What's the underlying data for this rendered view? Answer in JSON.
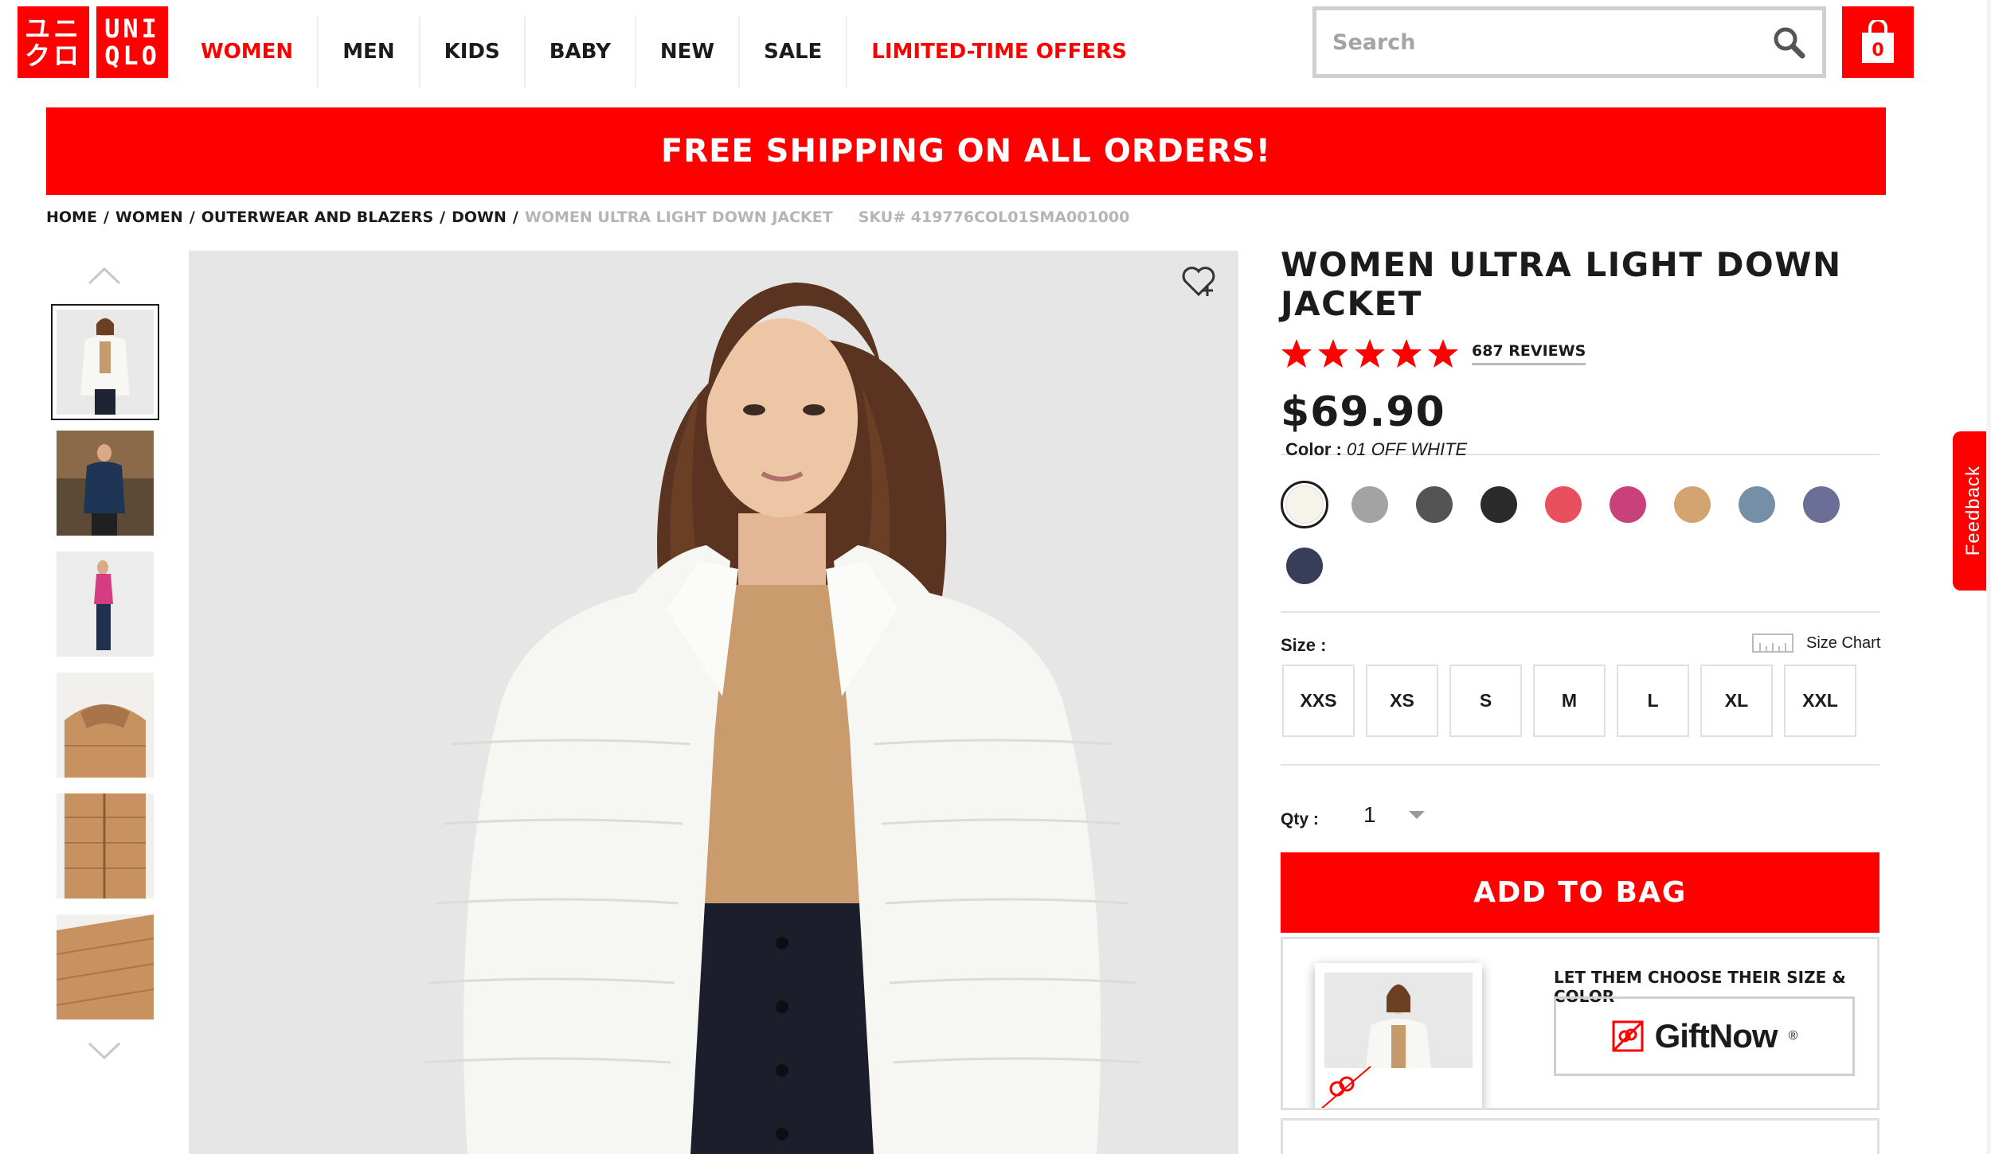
{
  "header": {
    "logo": {
      "top_left": "ユニ",
      "bottom_left": "クロ",
      "top_right": "UNI",
      "bottom_right": "QLO"
    },
    "nav": [
      {
        "label": "WOMEN",
        "color": "#ff0000"
      },
      {
        "label": "MEN"
      },
      {
        "label": "KIDS"
      },
      {
        "label": "BABY"
      },
      {
        "label": "NEW"
      },
      {
        "label": "SALE"
      },
      {
        "label": "LIMITED-TIME OFFERS",
        "color": "#ff0000"
      }
    ],
    "search": {
      "placeholder": "Search",
      "icon": "search-icon"
    },
    "bag": {
      "count": "0",
      "icon": "shopping-bag-icon"
    }
  },
  "banner": {
    "text": "FREE SHIPPING ON ALL ORDERS!"
  },
  "breadcrumb": {
    "items": [
      "HOME",
      "WOMEN",
      "OUTERWEAR AND BLAZERS",
      "DOWN"
    ],
    "current": "WOMEN ULTRA LIGHT DOWN JACKET",
    "sku": "SKU# 419776COL01SMA001000"
  },
  "gallery": {
    "thumbnail_count": 6,
    "active_index": 0
  },
  "product": {
    "title": "WOMEN ULTRA LIGHT DOWN JACKET",
    "rating": 5,
    "reviews": "687 REVIEWS",
    "price": "$69.90",
    "color_label": "Color :",
    "color_value": "01 OFF WHITE",
    "colors": [
      "#f6f4ea",
      "#a3a3a3",
      "#545454",
      "#2b2b2b",
      "#e8505e",
      "#c8417a",
      "#d3a470",
      "#7590a6",
      "#6b6e96",
      "#383d5a"
    ],
    "size_label": "Size :",
    "size_chart": "Size Chart",
    "sizes": [
      "XXS",
      "XS",
      "S",
      "M",
      "L",
      "XL",
      "XXL"
    ],
    "qty_label": "Qty :",
    "qty_value": "1",
    "add_to_bag": "ADD TO BAG"
  },
  "giftnow": {
    "title": "LET THEM CHOOSE THEIR SIZE & COLOR",
    "brand": "GiftNow",
    "reg": "®"
  },
  "feedback": {
    "label": "Feedback"
  },
  "colors": {
    "brand_red": "#ff0000",
    "text": "#1b1b1b",
    "muted": "#b5b5b5"
  }
}
